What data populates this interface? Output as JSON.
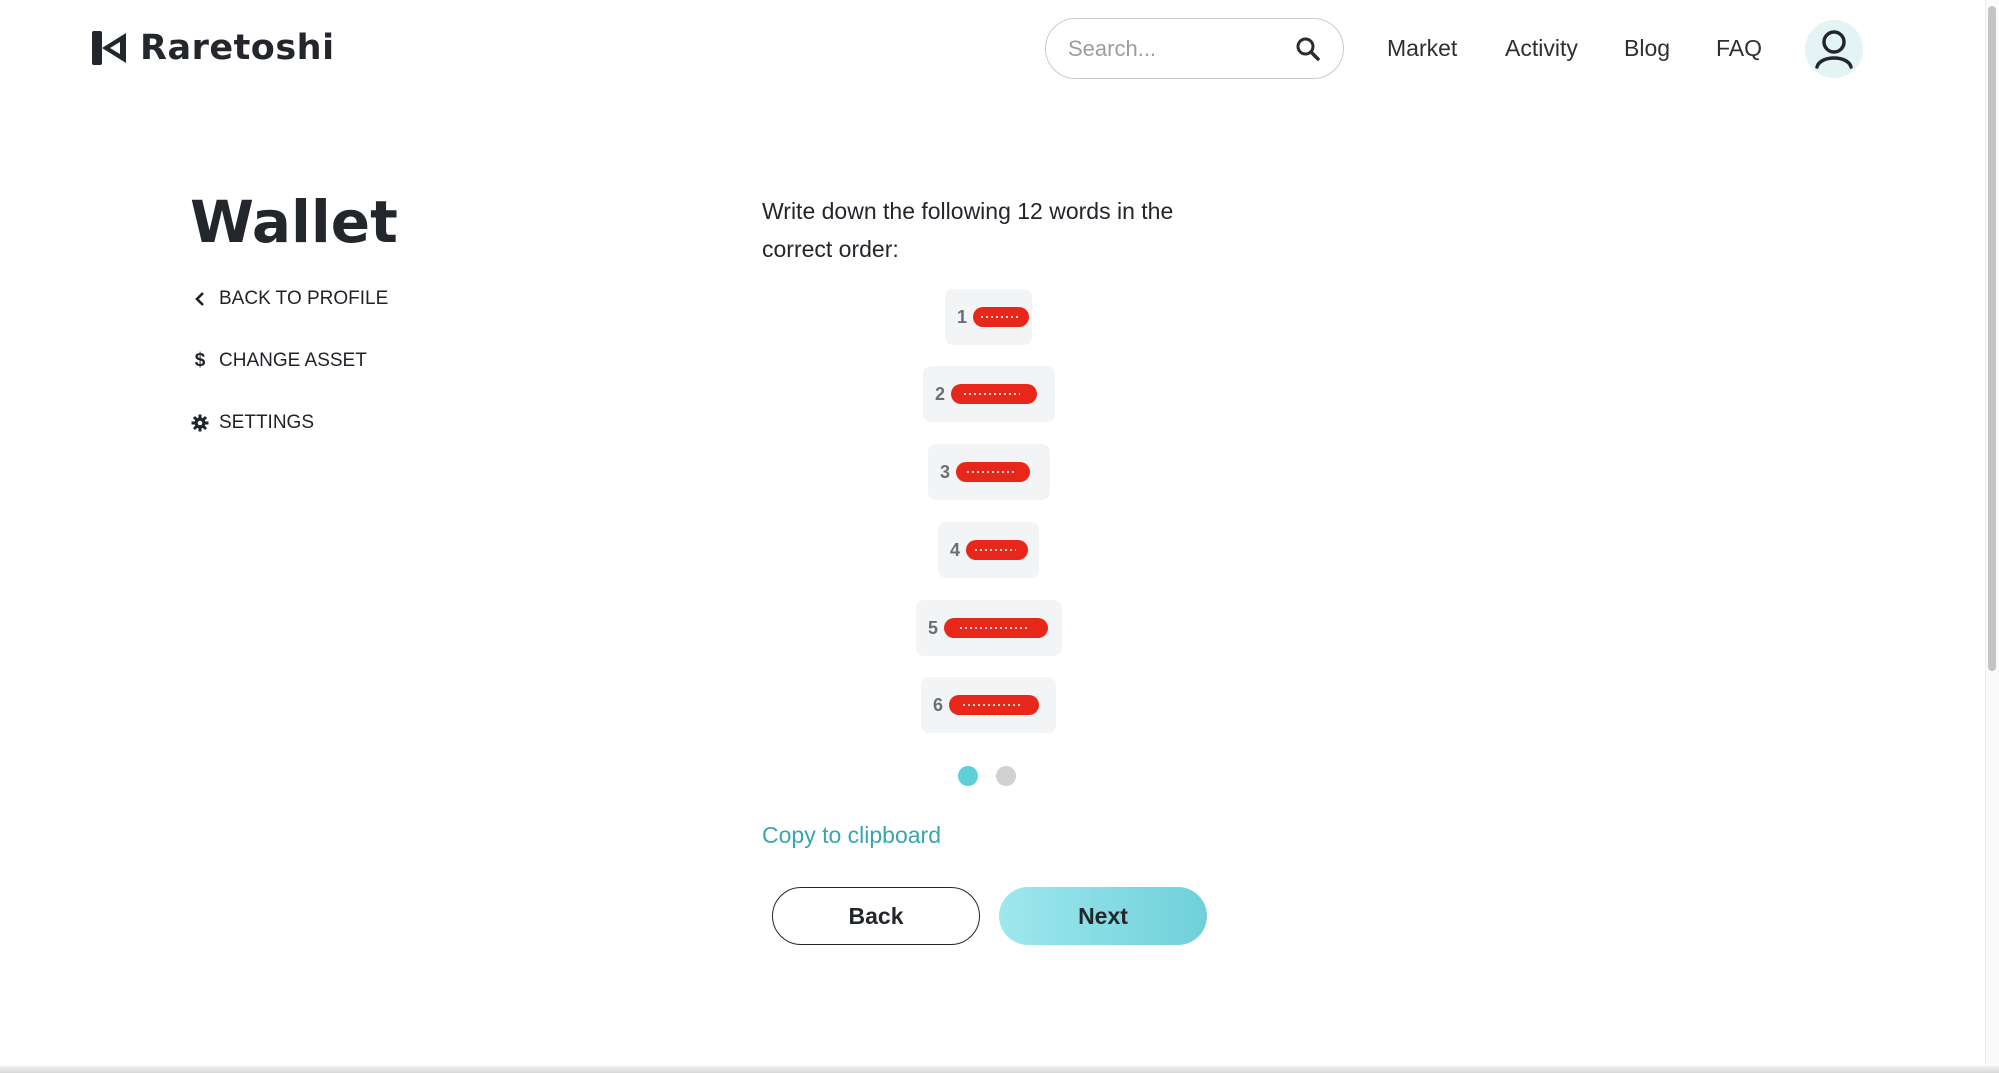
{
  "header": {
    "brand": "Raretoshi",
    "search_placeholder": "Search...",
    "nav": [
      "Market",
      "Activity",
      "Blog",
      "FAQ"
    ]
  },
  "sidebar": {
    "title": "Wallet",
    "items": [
      {
        "label": "BACK TO PROFILE",
        "icon": "chevron-left-icon"
      },
      {
        "label": "CHANGE ASSET",
        "icon": "dollar-icon"
      },
      {
        "label": "SETTINGS",
        "icon": "gear-icon"
      }
    ]
  },
  "main": {
    "instructions": "Write down the following 12 words in the correct order:",
    "words": [
      {
        "num": "1"
      },
      {
        "num": "2"
      },
      {
        "num": "3"
      },
      {
        "num": "4"
      },
      {
        "num": "5"
      },
      {
        "num": "6"
      }
    ],
    "pagination": {
      "pages": 2,
      "current": 1
    },
    "copy_label": "Copy to clipboard",
    "back_label": "Back",
    "next_label": "Next"
  },
  "colors": {
    "accent": "#5ccfd9",
    "link": "#3aa5b0",
    "redaction": "#e8271b",
    "inactive_dot": "#cfd1d3"
  }
}
